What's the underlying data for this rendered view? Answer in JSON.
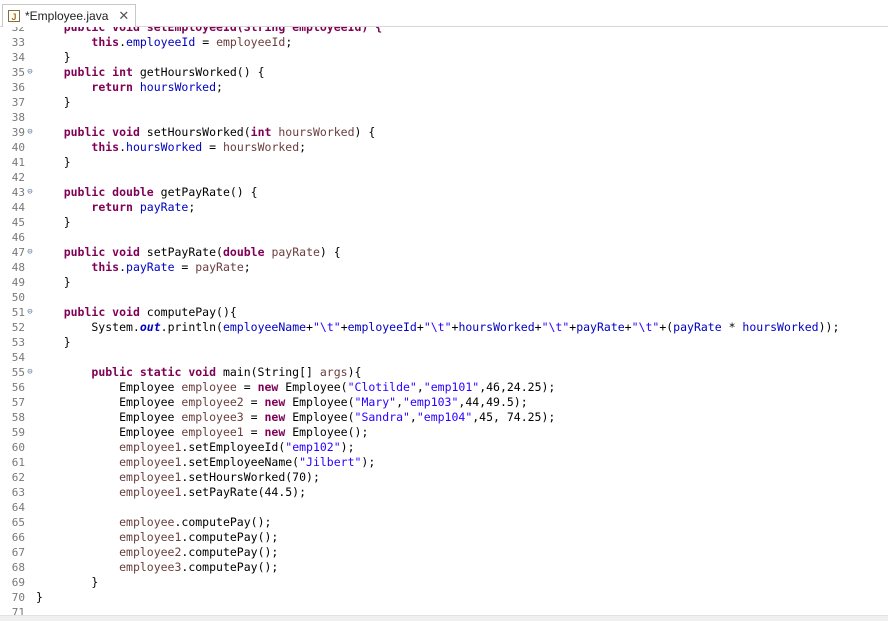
{
  "tab": {
    "title": "*Employee.java",
    "close_glyph": "✕",
    "icon": "java-file-icon"
  },
  "colors": {
    "keyword": "#7f0055",
    "field": "#0000c0",
    "string": "#2a00ff",
    "local": "#6a3e3e",
    "line_number": "#787878"
  },
  "lines": [
    {
      "n": "32",
      "fold": false,
      "segs": [
        [
          "    ",
          ""
        ],
        [
          "public void setEmployeeId(String employeeId) {",
          "kw"
        ]
      ],
      "clip": true
    },
    {
      "n": "33",
      "fold": false,
      "segs": [
        [
          "        ",
          ""
        ],
        [
          "this",
          "kw"
        ],
        [
          ".",
          ""
        ],
        [
          "employeeId",
          "field"
        ],
        [
          " = ",
          ""
        ],
        [
          "employeeId",
          "local"
        ],
        [
          ";",
          ""
        ]
      ]
    },
    {
      "n": "34",
      "fold": false,
      "segs": [
        [
          "    }",
          ""
        ]
      ]
    },
    {
      "n": "35",
      "fold": true,
      "segs": [
        [
          "    ",
          ""
        ],
        [
          "public int",
          "kw"
        ],
        [
          " getHoursWorked() {",
          ""
        ]
      ]
    },
    {
      "n": "36",
      "fold": false,
      "segs": [
        [
          "        ",
          ""
        ],
        [
          "return",
          "kw"
        ],
        [
          " ",
          ""
        ],
        [
          "hoursWorked",
          "field"
        ],
        [
          ";",
          ""
        ]
      ]
    },
    {
      "n": "37",
      "fold": false,
      "segs": [
        [
          "    }",
          ""
        ]
      ]
    },
    {
      "n": "38",
      "fold": false,
      "segs": []
    },
    {
      "n": "39",
      "fold": true,
      "segs": [
        [
          "    ",
          ""
        ],
        [
          "public void",
          "kw"
        ],
        [
          " setHoursWorked(",
          ""
        ],
        [
          "int",
          "kw"
        ],
        [
          " ",
          ""
        ],
        [
          "hoursWorked",
          "local"
        ],
        [
          ") {",
          ""
        ]
      ]
    },
    {
      "n": "40",
      "fold": false,
      "segs": [
        [
          "        ",
          ""
        ],
        [
          "this",
          "kw"
        ],
        [
          ".",
          ""
        ],
        [
          "hoursWorked",
          "field"
        ],
        [
          " = ",
          ""
        ],
        [
          "hoursWorked",
          "local"
        ],
        [
          ";",
          ""
        ]
      ]
    },
    {
      "n": "41",
      "fold": false,
      "segs": [
        [
          "    }",
          ""
        ]
      ]
    },
    {
      "n": "42",
      "fold": false,
      "segs": []
    },
    {
      "n": "43",
      "fold": true,
      "segs": [
        [
          "    ",
          ""
        ],
        [
          "public double",
          "kw"
        ],
        [
          " getPayRate() {",
          ""
        ]
      ]
    },
    {
      "n": "44",
      "fold": false,
      "segs": [
        [
          "        ",
          ""
        ],
        [
          "return",
          "kw"
        ],
        [
          " ",
          ""
        ],
        [
          "payRate",
          "field"
        ],
        [
          ";",
          ""
        ]
      ]
    },
    {
      "n": "45",
      "fold": false,
      "segs": [
        [
          "    }",
          ""
        ]
      ]
    },
    {
      "n": "46",
      "fold": false,
      "segs": []
    },
    {
      "n": "47",
      "fold": true,
      "segs": [
        [
          "    ",
          ""
        ],
        [
          "public void",
          "kw"
        ],
        [
          " setPayRate(",
          ""
        ],
        [
          "double",
          "kw"
        ],
        [
          " ",
          ""
        ],
        [
          "payRate",
          "local"
        ],
        [
          ") {",
          ""
        ]
      ]
    },
    {
      "n": "48",
      "fold": false,
      "segs": [
        [
          "        ",
          ""
        ],
        [
          "this",
          "kw"
        ],
        [
          ".",
          ""
        ],
        [
          "payRate",
          "field"
        ],
        [
          " = ",
          ""
        ],
        [
          "payRate",
          "local"
        ],
        [
          ";",
          ""
        ]
      ]
    },
    {
      "n": "49",
      "fold": false,
      "segs": [
        [
          "    }",
          ""
        ]
      ]
    },
    {
      "n": "50",
      "fold": false,
      "segs": []
    },
    {
      "n": "51",
      "fold": true,
      "segs": [
        [
          "    ",
          ""
        ],
        [
          "public void",
          "kw"
        ],
        [
          " computePay(){",
          ""
        ]
      ]
    },
    {
      "n": "52",
      "fold": false,
      "segs": [
        [
          "        System.",
          ""
        ],
        [
          "out",
          "static"
        ],
        [
          ".println(",
          ""
        ],
        [
          "employeeName",
          "field"
        ],
        [
          "+",
          ""
        ],
        [
          "\"\\t\"",
          "str"
        ],
        [
          "+",
          ""
        ],
        [
          "employeeId",
          "field"
        ],
        [
          "+",
          ""
        ],
        [
          "\"\\t\"",
          "str"
        ],
        [
          "+",
          ""
        ],
        [
          "hoursWorked",
          "field"
        ],
        [
          "+",
          ""
        ],
        [
          "\"\\t\"",
          "str"
        ],
        [
          "+",
          ""
        ],
        [
          "payRate",
          "field"
        ],
        [
          "+",
          ""
        ],
        [
          "\"\\t\"",
          "str"
        ],
        [
          "+(",
          ""
        ],
        [
          "payRate",
          "field"
        ],
        [
          " * ",
          ""
        ],
        [
          "hoursWorked",
          "field"
        ],
        [
          "));",
          ""
        ]
      ]
    },
    {
      "n": "53",
      "fold": false,
      "segs": [
        [
          "    }",
          ""
        ]
      ]
    },
    {
      "n": "54",
      "fold": false,
      "segs": []
    },
    {
      "n": "55",
      "fold": true,
      "segs": [
        [
          "        ",
          ""
        ],
        [
          "public static void",
          "kw"
        ],
        [
          " main(String[] ",
          ""
        ],
        [
          "args",
          "local"
        ],
        [
          "){",
          ""
        ]
      ]
    },
    {
      "n": "56",
      "fold": false,
      "segs": [
        [
          "            Employee ",
          ""
        ],
        [
          "employee",
          "local"
        ],
        [
          " = ",
          ""
        ],
        [
          "new",
          "kw"
        ],
        [
          " Employee(",
          ""
        ],
        [
          "\"Clotilde\"",
          "str"
        ],
        [
          ",",
          ""
        ],
        [
          "\"emp101\"",
          "str"
        ],
        [
          ",46,24.25);",
          ""
        ]
      ]
    },
    {
      "n": "57",
      "fold": false,
      "segs": [
        [
          "            Employee ",
          ""
        ],
        [
          "employee2",
          "local"
        ],
        [
          " = ",
          ""
        ],
        [
          "new",
          "kw"
        ],
        [
          " Employee(",
          ""
        ],
        [
          "\"Mary\"",
          "str"
        ],
        [
          ",",
          ""
        ],
        [
          "\"emp103\"",
          "str"
        ],
        [
          ",44,49.5);",
          ""
        ]
      ]
    },
    {
      "n": "58",
      "fold": false,
      "segs": [
        [
          "            Employee ",
          ""
        ],
        [
          "employee3",
          "local"
        ],
        [
          " = ",
          ""
        ],
        [
          "new",
          "kw"
        ],
        [
          " Employee(",
          ""
        ],
        [
          "\"Sandra\"",
          "str"
        ],
        [
          ",",
          ""
        ],
        [
          "\"emp104\"",
          "str"
        ],
        [
          ",45, 74.25);",
          ""
        ]
      ]
    },
    {
      "n": "59",
      "fold": false,
      "segs": [
        [
          "            Employee ",
          ""
        ],
        [
          "employee1",
          "local"
        ],
        [
          " = ",
          ""
        ],
        [
          "new",
          "kw"
        ],
        [
          " Employee();",
          ""
        ]
      ]
    },
    {
      "n": "60",
      "fold": false,
      "segs": [
        [
          "            ",
          ""
        ],
        [
          "employee1",
          "local"
        ],
        [
          ".setEmployeeId(",
          ""
        ],
        [
          "\"emp102\"",
          "str"
        ],
        [
          ");",
          ""
        ]
      ]
    },
    {
      "n": "61",
      "fold": false,
      "segs": [
        [
          "            ",
          ""
        ],
        [
          "employee1",
          "local"
        ],
        [
          ".setEmployeeName(",
          ""
        ],
        [
          "\"Jilbert\"",
          "str"
        ],
        [
          ");",
          ""
        ]
      ]
    },
    {
      "n": "62",
      "fold": false,
      "segs": [
        [
          "            ",
          ""
        ],
        [
          "employee1",
          "local"
        ],
        [
          ".setHoursWorked(70);",
          ""
        ]
      ]
    },
    {
      "n": "63",
      "fold": false,
      "segs": [
        [
          "            ",
          ""
        ],
        [
          "employee1",
          "local"
        ],
        [
          ".setPayRate(44.5);",
          ""
        ]
      ]
    },
    {
      "n": "64",
      "fold": false,
      "segs": []
    },
    {
      "n": "65",
      "fold": false,
      "segs": [
        [
          "            ",
          ""
        ],
        [
          "employee",
          "local"
        ],
        [
          ".computePay();",
          ""
        ]
      ]
    },
    {
      "n": "66",
      "fold": false,
      "segs": [
        [
          "            ",
          ""
        ],
        [
          "employee1",
          "local"
        ],
        [
          ".computePay();",
          ""
        ]
      ]
    },
    {
      "n": "67",
      "fold": false,
      "segs": [
        [
          "            ",
          ""
        ],
        [
          "employee2",
          "local"
        ],
        [
          ".computePay();",
          ""
        ]
      ]
    },
    {
      "n": "68",
      "fold": false,
      "segs": [
        [
          "            ",
          ""
        ],
        [
          "employee3",
          "local"
        ],
        [
          ".computePay();",
          ""
        ]
      ]
    },
    {
      "n": "69",
      "fold": false,
      "segs": [
        [
          "        }",
          ""
        ]
      ]
    },
    {
      "n": "70",
      "fold": false,
      "segs": [
        [
          "}",
          ""
        ]
      ]
    },
    {
      "n": "71",
      "fold": false,
      "segs": []
    }
  ]
}
